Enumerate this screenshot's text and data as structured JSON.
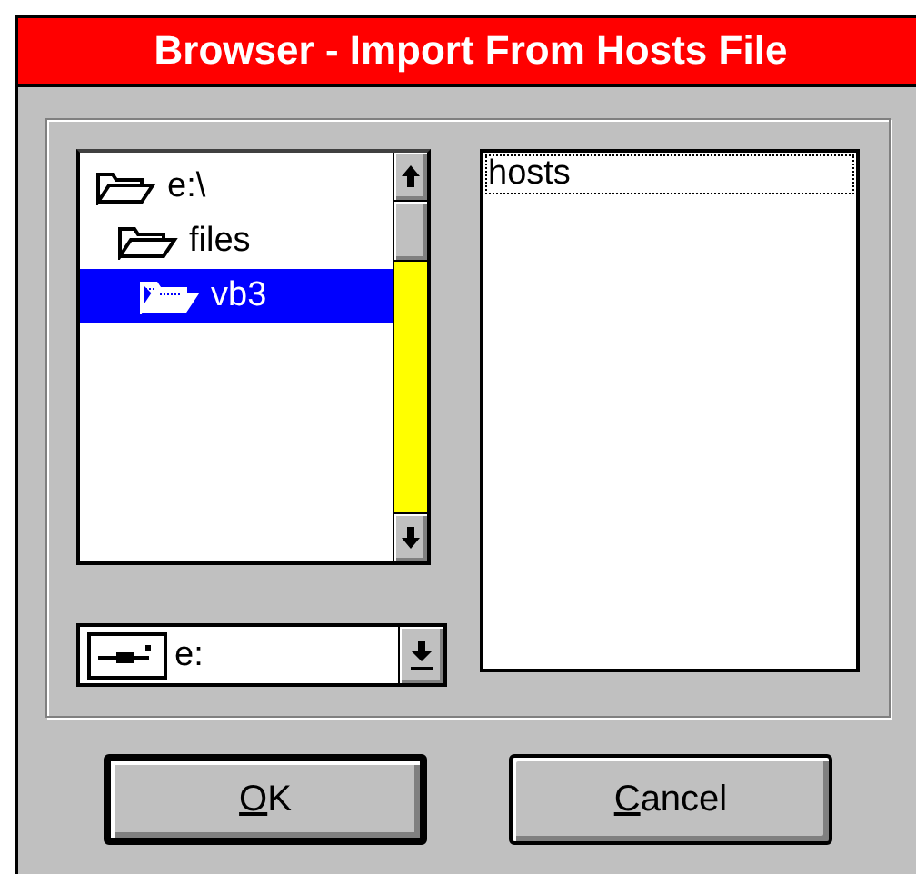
{
  "window": {
    "title": "Browser - Import From Hosts File"
  },
  "folders": [
    {
      "label": "e:\\",
      "selected": false,
      "children": [
        {
          "label": "files",
          "selected": false,
          "children": [
            {
              "label": "vb3",
              "selected": true
            }
          ]
        }
      ]
    }
  ],
  "files": [
    {
      "label": "hosts",
      "selected": true
    }
  ],
  "drive": {
    "value": "e:"
  },
  "buttons": [
    {
      "label": "OK",
      "default": true
    },
    {
      "label": "Cancel",
      "default": false
    }
  ]
}
